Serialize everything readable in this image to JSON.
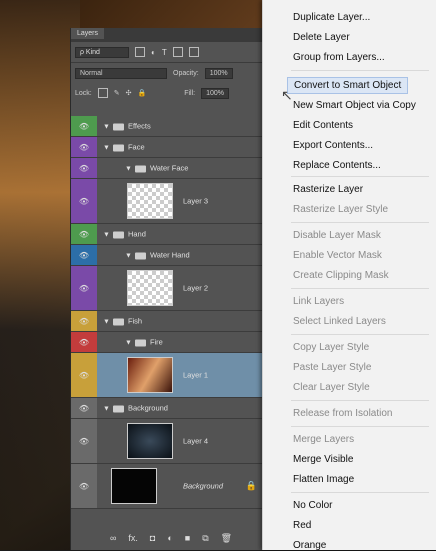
{
  "panel": {
    "tab": "Layers",
    "kind_label": "ρ Kind",
    "blend_mode": "Normal",
    "opacity_label": "Opacity:",
    "opacity_value": "100%",
    "lock_label": "Lock:",
    "fill_label": "Fill:",
    "fill_value": "100%"
  },
  "layers": [
    {
      "name": "Effects",
      "type": "group",
      "color": "#4e9b4e"
    },
    {
      "name": "Face",
      "type": "group",
      "color": "#7a4aa8"
    },
    {
      "name": "Water Face",
      "type": "group",
      "color": "#7a4aa8",
      "indent": true
    },
    {
      "name": "Layer 3",
      "type": "layer",
      "color": "#7a4aa8"
    },
    {
      "name": "Hand",
      "type": "group",
      "color": "#4e9b4e"
    },
    {
      "name": "Water Hand",
      "type": "group",
      "color": "#2c6ea8",
      "indent": true
    },
    {
      "name": "Layer 2",
      "type": "layer",
      "color": "#7a4aa8"
    },
    {
      "name": "Fish",
      "type": "group",
      "color": "#c8a03a"
    },
    {
      "name": "Fire",
      "type": "group",
      "color": "#c33c3c",
      "indent": true
    },
    {
      "name": "Layer 1",
      "type": "layer",
      "color": "#c8a03a",
      "selected": true
    },
    {
      "name": "Background",
      "type": "group",
      "color": "#6a6a6a"
    },
    {
      "name": "Layer 4",
      "type": "layer",
      "color": "#6a6a6a"
    },
    {
      "name": "Background",
      "type": "background",
      "color": "#6a6a6a"
    }
  ],
  "bottom_tools": [
    "∞",
    "fx.",
    "◘",
    "◐",
    "■",
    "⧉",
    "🗑"
  ],
  "menu": [
    {
      "label": "Duplicate Layer...",
      "state": "normal"
    },
    {
      "label": "Delete Layer",
      "state": "normal"
    },
    {
      "label": "Group from Layers...",
      "state": "normal"
    },
    {
      "label": "Convert to Smart Object",
      "state": "highlighted"
    },
    {
      "label": "New Smart Object via Copy",
      "state": "normal"
    },
    {
      "label": "Edit Contents",
      "state": "normal"
    },
    {
      "label": "Export Contents...",
      "state": "normal"
    },
    {
      "label": "Replace Contents...",
      "state": "normal"
    },
    {
      "label": "Rasterize Layer",
      "state": "normal"
    },
    {
      "label": "Rasterize Layer Style",
      "state": "disabled"
    },
    {
      "label": "Disable Layer Mask",
      "state": "disabled"
    },
    {
      "label": "Enable Vector Mask",
      "state": "disabled"
    },
    {
      "label": "Create Clipping Mask",
      "state": "disabled"
    },
    {
      "label": "Link Layers",
      "state": "disabled"
    },
    {
      "label": "Select Linked Layers",
      "state": "disabled"
    },
    {
      "label": "Copy Layer Style",
      "state": "disabled"
    },
    {
      "label": "Paste Layer Style",
      "state": "disabled"
    },
    {
      "label": "Clear Layer Style",
      "state": "disabled"
    },
    {
      "label": "Release from Isolation",
      "state": "disabled"
    },
    {
      "label": "Merge Layers",
      "state": "disabled"
    },
    {
      "label": "Merge Visible",
      "state": "normal"
    },
    {
      "label": "Flatten Image",
      "state": "normal"
    },
    {
      "label": "No Color",
      "state": "normal"
    },
    {
      "label": "Red",
      "state": "normal"
    },
    {
      "label": "Orange",
      "state": "normal"
    }
  ]
}
